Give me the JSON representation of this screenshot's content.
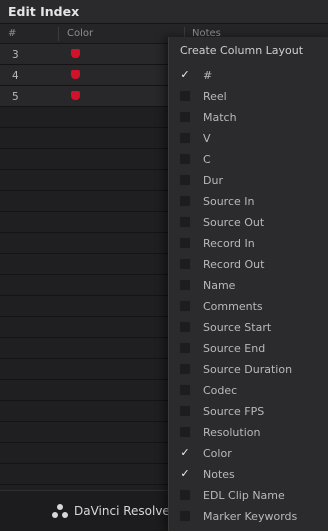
{
  "panel": {
    "title": "Edit Index"
  },
  "columns": {
    "hash": "#",
    "color": "Color",
    "notes": "Notes"
  },
  "rows": [
    {
      "number": "3",
      "color": "#d0132b"
    },
    {
      "number": "4",
      "color": "#d0132b"
    },
    {
      "number": "5",
      "color": "#d0132b"
    }
  ],
  "footer": {
    "app_name": "DaVinci Resolve",
    "logo_icon": "davinci-resolve-logo-icon"
  },
  "menu": {
    "title": "Create Column Layout",
    "items": [
      {
        "label": "#",
        "checked": true
      },
      {
        "label": "Reel",
        "checked": false
      },
      {
        "label": "Match",
        "checked": false
      },
      {
        "label": "V",
        "checked": false
      },
      {
        "label": "C",
        "checked": false
      },
      {
        "label": "Dur",
        "checked": false
      },
      {
        "label": "Source In",
        "checked": false
      },
      {
        "label": "Source Out",
        "checked": false
      },
      {
        "label": "Record In",
        "checked": false
      },
      {
        "label": "Record Out",
        "checked": false
      },
      {
        "label": "Name",
        "checked": false
      },
      {
        "label": "Comments",
        "checked": false
      },
      {
        "label": "Source Start",
        "checked": false
      },
      {
        "label": "Source End",
        "checked": false
      },
      {
        "label": "Source Duration",
        "checked": false
      },
      {
        "label": "Codec",
        "checked": false
      },
      {
        "label": "Source FPS",
        "checked": false
      },
      {
        "label": "Resolution",
        "checked": false
      },
      {
        "label": "Color",
        "checked": true
      },
      {
        "label": "Notes",
        "checked": true
      },
      {
        "label": "EDL Clip Name",
        "checked": false
      },
      {
        "label": "Marker Keywords",
        "checked": false
      }
    ]
  }
}
